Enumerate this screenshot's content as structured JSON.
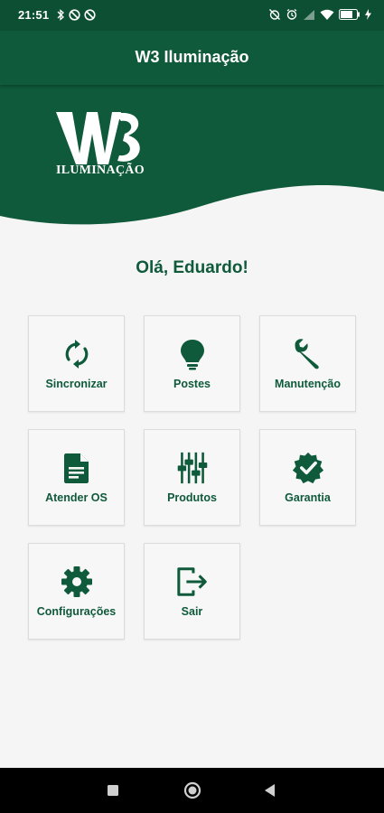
{
  "status_bar": {
    "time": "21:51",
    "left_icons": [
      "bluetooth-icon",
      "dnd-icon",
      "dnd-icon"
    ],
    "right_icons": [
      "alarm-off-icon",
      "alarm-icon",
      "signal-icon",
      "wifi-icon",
      "battery-icon",
      "charging-icon"
    ]
  },
  "app_bar": {
    "title": "W3 Iluminação"
  },
  "brand": {
    "logo_main": "W3",
    "logo_sub": "ILUMINAÇÃO"
  },
  "greeting": "Olá, Eduardo!",
  "menu": [
    {
      "label": "Sincronizar",
      "icon": "sync-icon"
    },
    {
      "label": "Postes",
      "icon": "lightbulb-icon"
    },
    {
      "label": "Manutenção",
      "icon": "wrench-icon"
    },
    {
      "label": "Atender OS",
      "icon": "document-icon"
    },
    {
      "label": "Produtos",
      "icon": "sliders-icon"
    },
    {
      "label": "Garantia",
      "icon": "badge-check-icon"
    },
    {
      "label": "Configurações",
      "icon": "gear-icon"
    },
    {
      "label": "Sair",
      "icon": "logout-icon"
    }
  ],
  "navigation_bar": {
    "buttons": [
      "recents-button",
      "home-button",
      "back-button"
    ]
  },
  "colors": {
    "primary": "#0e5a3a",
    "status_bar": "#0d4f33",
    "background": "#f5f5f5",
    "tile": "#f7f7f7"
  }
}
